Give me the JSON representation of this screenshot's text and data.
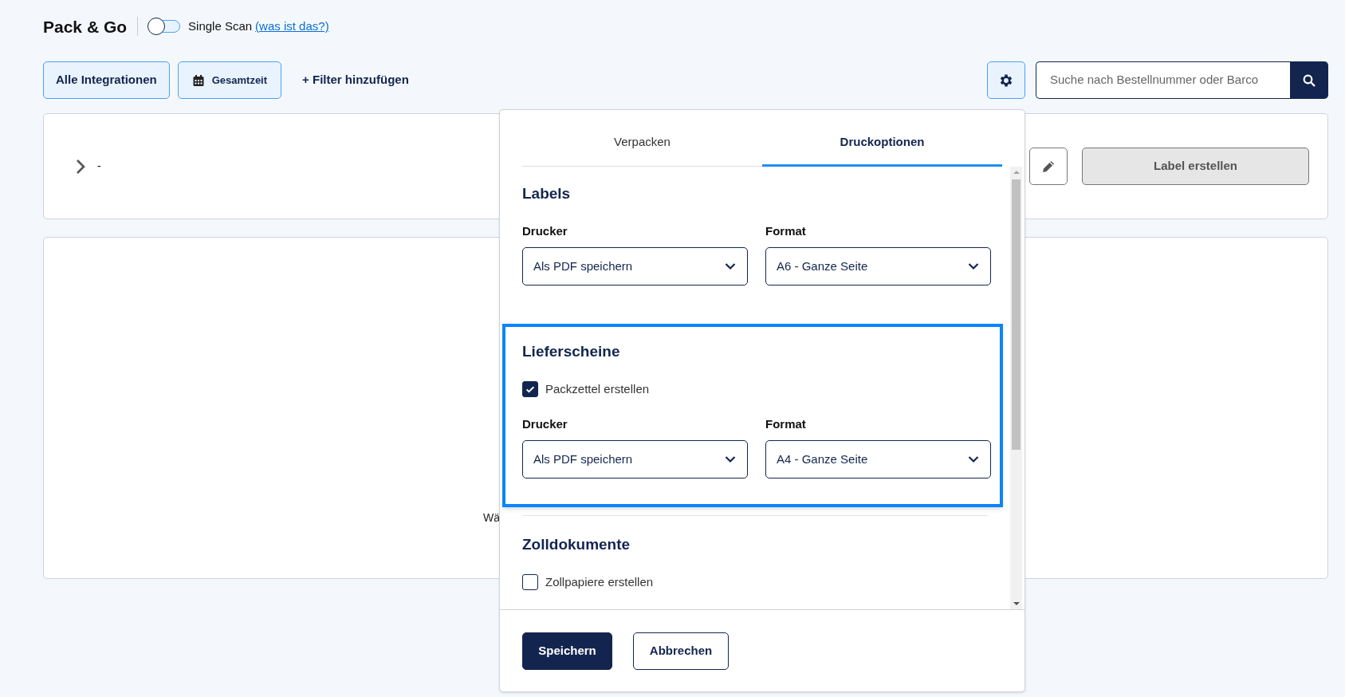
{
  "header": {
    "title": "Pack & Go",
    "single_scan": {
      "label": "Single Scan",
      "on": false
    },
    "help_link": "(was ist das?)"
  },
  "filters": [
    {
      "label": "Alle Integrationen",
      "kind": "plain"
    },
    {
      "label": "Gesamtzeit",
      "kind": "date"
    }
  ],
  "add_filter": "+ Filter hinzufügen",
  "search": {
    "placeholder": "Suche nach Bestellnummer oder Barco"
  },
  "order_row": {
    "expanded": false,
    "text": "-",
    "create_label": {
      "label": "Label erstellen",
      "disabled": true
    }
  },
  "empty_state": {
    "text": "Wä"
  },
  "settings_popover": {
    "tabs": [
      {
        "label": "Verpacken",
        "selected": false
      },
      {
        "label": "Druckoptionen",
        "selected": true
      }
    ],
    "sections": [
      {
        "title": "Labels",
        "highlighted": false,
        "fields": [
          {
            "label": "Drucker",
            "value": "Als PDF speichern"
          },
          {
            "label": "Format",
            "value": "A6 - Ganze Seite"
          }
        ]
      },
      {
        "title": "Lieferscheine",
        "highlighted": true,
        "checkbox": {
          "label": "Packzettel erstellen",
          "checked": true
        },
        "fields": [
          {
            "label": "Drucker",
            "value": "Als PDF speichern"
          },
          {
            "label": "Format",
            "value": "A4 - Ganze Seite"
          }
        ]
      },
      {
        "title": "Zolldokumente",
        "highlighted": false,
        "checkbox": {
          "label": "Zollpapiere erstellen",
          "checked": false
        }
      }
    ],
    "buttons": [
      {
        "label": "Speichern",
        "kind": "primary"
      },
      {
        "label": "Abbrechen",
        "kind": "secondary"
      }
    ]
  }
}
